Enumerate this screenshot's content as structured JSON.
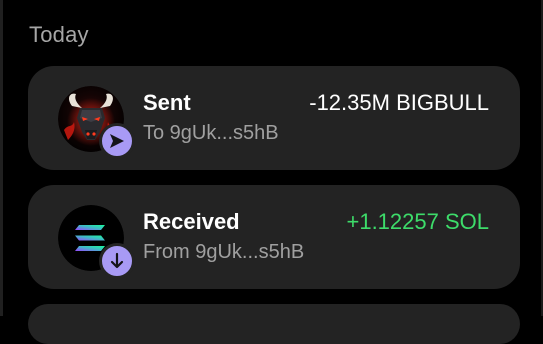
{
  "section": {
    "title": "Today"
  },
  "colors": {
    "background": "#000000",
    "card": "#232323",
    "badge": "#a89af5",
    "positive_amount": "#3ddc6a",
    "secondary_text": "#a0a0a0"
  },
  "transactions": [
    {
      "title": "Sent",
      "subtitle": "To 9gUk...s5hB",
      "amount": "-12.35M BIGBULL",
      "token_icon": "bigbull-token-icon",
      "direction_icon": "send-arrow-icon"
    },
    {
      "title": "Received",
      "subtitle": "From 9gUk...s5hB",
      "amount": "+1.12257 SOL",
      "token_icon": "solana-token-icon",
      "direction_icon": "arrow-down-icon"
    }
  ]
}
